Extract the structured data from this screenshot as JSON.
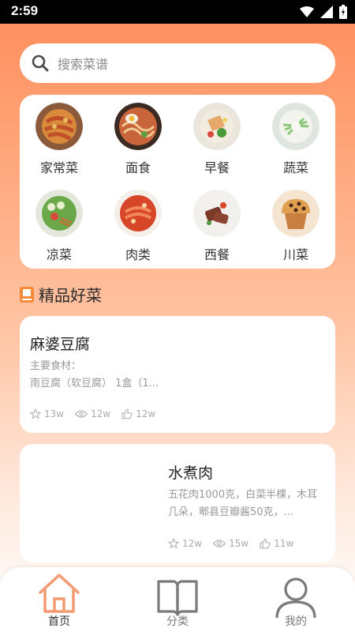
{
  "status_bar": {
    "time": "2:59"
  },
  "search": {
    "placeholder": "搜索菜谱"
  },
  "categories": [
    {
      "label": "家常菜",
      "icon": "stir-fry-dish-icon"
    },
    {
      "label": "面食",
      "icon": "noodle-bowl-icon"
    },
    {
      "label": "早餐",
      "icon": "breakfast-plate-icon"
    },
    {
      "label": "蔬菜",
      "icon": "vegetable-dish-icon"
    },
    {
      "label": "凉菜",
      "icon": "cold-salad-icon"
    },
    {
      "label": "肉类",
      "icon": "meat-stew-icon"
    },
    {
      "label": "西餐",
      "icon": "steak-plate-icon"
    },
    {
      "label": "川菜",
      "icon": "muffin-icon"
    }
  ],
  "section": {
    "title": "精品好菜"
  },
  "recipes": [
    {
      "name": "麻婆豆腐",
      "ingredients_label": "主要食材：",
      "ingredients": "南豆腐（软豆腐） 1盒（1...",
      "stats": {
        "favorites": "13w",
        "views": "12w",
        "likes": "12w"
      }
    },
    {
      "name": "水煮肉",
      "ingredients": "五花肉1000克，白菜半棵，木耳几朵，郫县豆瓣酱50克，...",
      "stats": {
        "favorites": "12w",
        "views": "15w",
        "likes": "11w"
      }
    }
  ],
  "bottom_nav": [
    {
      "label": "首页",
      "active": true
    },
    {
      "label": "分类",
      "active": false
    },
    {
      "label": "我的",
      "active": false
    }
  ],
  "colors": {
    "accent": "#FF8C5A",
    "active_nav": "#F39A70",
    "inactive_nav": "#7A7A7A"
  }
}
